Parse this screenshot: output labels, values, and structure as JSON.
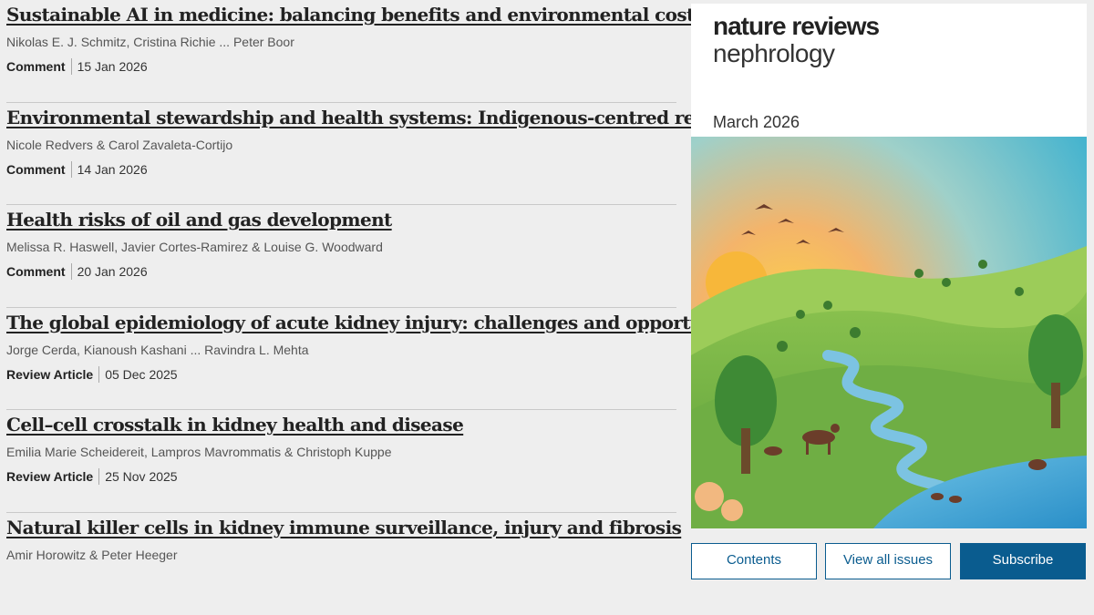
{
  "articles": [
    {
      "title": "Sustainable AI in medicine: balancing benefits and environmental costs",
      "authors": "Nikolas E. J. Schmitz, Cristina Richie ... Peter Boor",
      "type": "Comment",
      "date": "15 Jan 2026"
    },
    {
      "title": "Environmental stewardship and health systems: Indigenous-centred reflections",
      "authors": "Nicole Redvers & Carol Zavaleta-Cortijo",
      "type": "Comment",
      "date": "14 Jan 2026"
    },
    {
      "title": "Health risks of oil and gas development",
      "authors": "Melissa R. Haswell, Javier Cortes-Ramirez & Louise G. Woodward",
      "type": "Comment",
      "date": "20 Jan 2026"
    },
    {
      "title": "The global epidemiology of acute kidney injury: challenges and opportunities",
      "authors": "Jorge Cerda, Kianoush Kashani ... Ravindra L. Mehta",
      "type": "Review Article",
      "date": "05 Dec 2025"
    },
    {
      "title": "Cell–cell crosstalk in kidney health and disease",
      "authors": "Emilia Marie Scheidereit, Lampros Mavrommatis & Christoph Kuppe",
      "type": "Review Article",
      "date": "25 Nov 2025"
    },
    {
      "title": "Natural killer cells in kidney immune surveillance, injury and fibrosis",
      "authors": "Amir Horowitz & Peter Heeger",
      "type": "",
      "date": ""
    }
  ],
  "cover": {
    "brand_line1": "nature reviews",
    "brand_line2": "nephrology",
    "issue": "March 2026"
  },
  "buttons": {
    "contents": "Contents",
    "view_all": "View all issues",
    "subscribe": "Subscribe"
  },
  "colors": {
    "accent": "#0a5c8f"
  }
}
